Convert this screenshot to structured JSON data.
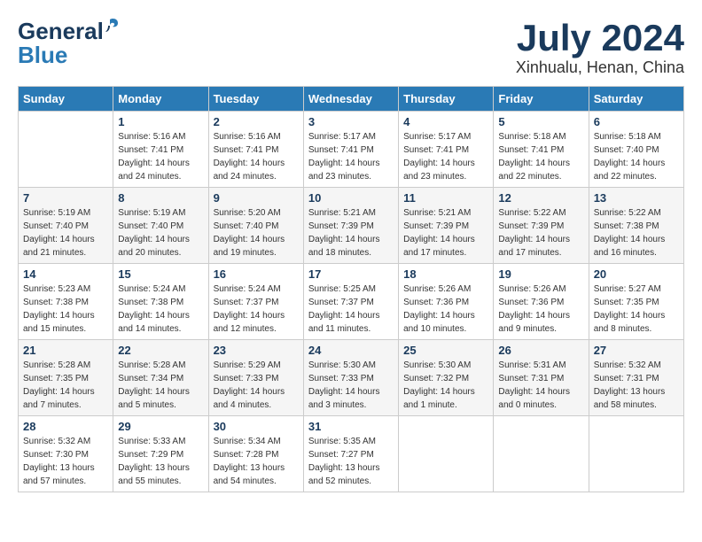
{
  "logo": {
    "line1": "General",
    "line2": "Blue"
  },
  "title": "July 2024",
  "location": "Xinhualu, Henan, China",
  "weekdays": [
    "Sunday",
    "Monday",
    "Tuesday",
    "Wednesday",
    "Thursday",
    "Friday",
    "Saturday"
  ],
  "weeks": [
    [
      {
        "day": "",
        "info": ""
      },
      {
        "day": "1",
        "info": "Sunrise: 5:16 AM\nSunset: 7:41 PM\nDaylight: 14 hours\nand 24 minutes."
      },
      {
        "day": "2",
        "info": "Sunrise: 5:16 AM\nSunset: 7:41 PM\nDaylight: 14 hours\nand 24 minutes."
      },
      {
        "day": "3",
        "info": "Sunrise: 5:17 AM\nSunset: 7:41 PM\nDaylight: 14 hours\nand 23 minutes."
      },
      {
        "day": "4",
        "info": "Sunrise: 5:17 AM\nSunset: 7:41 PM\nDaylight: 14 hours\nand 23 minutes."
      },
      {
        "day": "5",
        "info": "Sunrise: 5:18 AM\nSunset: 7:41 PM\nDaylight: 14 hours\nand 22 minutes."
      },
      {
        "day": "6",
        "info": "Sunrise: 5:18 AM\nSunset: 7:40 PM\nDaylight: 14 hours\nand 22 minutes."
      }
    ],
    [
      {
        "day": "7",
        "info": "Sunrise: 5:19 AM\nSunset: 7:40 PM\nDaylight: 14 hours\nand 21 minutes."
      },
      {
        "day": "8",
        "info": "Sunrise: 5:19 AM\nSunset: 7:40 PM\nDaylight: 14 hours\nand 20 minutes."
      },
      {
        "day": "9",
        "info": "Sunrise: 5:20 AM\nSunset: 7:40 PM\nDaylight: 14 hours\nand 19 minutes."
      },
      {
        "day": "10",
        "info": "Sunrise: 5:21 AM\nSunset: 7:39 PM\nDaylight: 14 hours\nand 18 minutes."
      },
      {
        "day": "11",
        "info": "Sunrise: 5:21 AM\nSunset: 7:39 PM\nDaylight: 14 hours\nand 17 minutes."
      },
      {
        "day": "12",
        "info": "Sunrise: 5:22 AM\nSunset: 7:39 PM\nDaylight: 14 hours\nand 17 minutes."
      },
      {
        "day": "13",
        "info": "Sunrise: 5:22 AM\nSunset: 7:38 PM\nDaylight: 14 hours\nand 16 minutes."
      }
    ],
    [
      {
        "day": "14",
        "info": "Sunrise: 5:23 AM\nSunset: 7:38 PM\nDaylight: 14 hours\nand 15 minutes."
      },
      {
        "day": "15",
        "info": "Sunrise: 5:24 AM\nSunset: 7:38 PM\nDaylight: 14 hours\nand 14 minutes."
      },
      {
        "day": "16",
        "info": "Sunrise: 5:24 AM\nSunset: 7:37 PM\nDaylight: 14 hours\nand 12 minutes."
      },
      {
        "day": "17",
        "info": "Sunrise: 5:25 AM\nSunset: 7:37 PM\nDaylight: 14 hours\nand 11 minutes."
      },
      {
        "day": "18",
        "info": "Sunrise: 5:26 AM\nSunset: 7:36 PM\nDaylight: 14 hours\nand 10 minutes."
      },
      {
        "day": "19",
        "info": "Sunrise: 5:26 AM\nSunset: 7:36 PM\nDaylight: 14 hours\nand 9 minutes."
      },
      {
        "day": "20",
        "info": "Sunrise: 5:27 AM\nSunset: 7:35 PM\nDaylight: 14 hours\nand 8 minutes."
      }
    ],
    [
      {
        "day": "21",
        "info": "Sunrise: 5:28 AM\nSunset: 7:35 PM\nDaylight: 14 hours\nand 7 minutes."
      },
      {
        "day": "22",
        "info": "Sunrise: 5:28 AM\nSunset: 7:34 PM\nDaylight: 14 hours\nand 5 minutes."
      },
      {
        "day": "23",
        "info": "Sunrise: 5:29 AM\nSunset: 7:33 PM\nDaylight: 14 hours\nand 4 minutes."
      },
      {
        "day": "24",
        "info": "Sunrise: 5:30 AM\nSunset: 7:33 PM\nDaylight: 14 hours\nand 3 minutes."
      },
      {
        "day": "25",
        "info": "Sunrise: 5:30 AM\nSunset: 7:32 PM\nDaylight: 14 hours\nand 1 minute."
      },
      {
        "day": "26",
        "info": "Sunrise: 5:31 AM\nSunset: 7:31 PM\nDaylight: 14 hours\nand 0 minutes."
      },
      {
        "day": "27",
        "info": "Sunrise: 5:32 AM\nSunset: 7:31 PM\nDaylight: 13 hours\nand 58 minutes."
      }
    ],
    [
      {
        "day": "28",
        "info": "Sunrise: 5:32 AM\nSunset: 7:30 PM\nDaylight: 13 hours\nand 57 minutes."
      },
      {
        "day": "29",
        "info": "Sunrise: 5:33 AM\nSunset: 7:29 PM\nDaylight: 13 hours\nand 55 minutes."
      },
      {
        "day": "30",
        "info": "Sunrise: 5:34 AM\nSunset: 7:28 PM\nDaylight: 13 hours\nand 54 minutes."
      },
      {
        "day": "31",
        "info": "Sunrise: 5:35 AM\nSunset: 7:27 PM\nDaylight: 13 hours\nand 52 minutes."
      },
      {
        "day": "",
        "info": ""
      },
      {
        "day": "",
        "info": ""
      },
      {
        "day": "",
        "info": ""
      }
    ]
  ]
}
